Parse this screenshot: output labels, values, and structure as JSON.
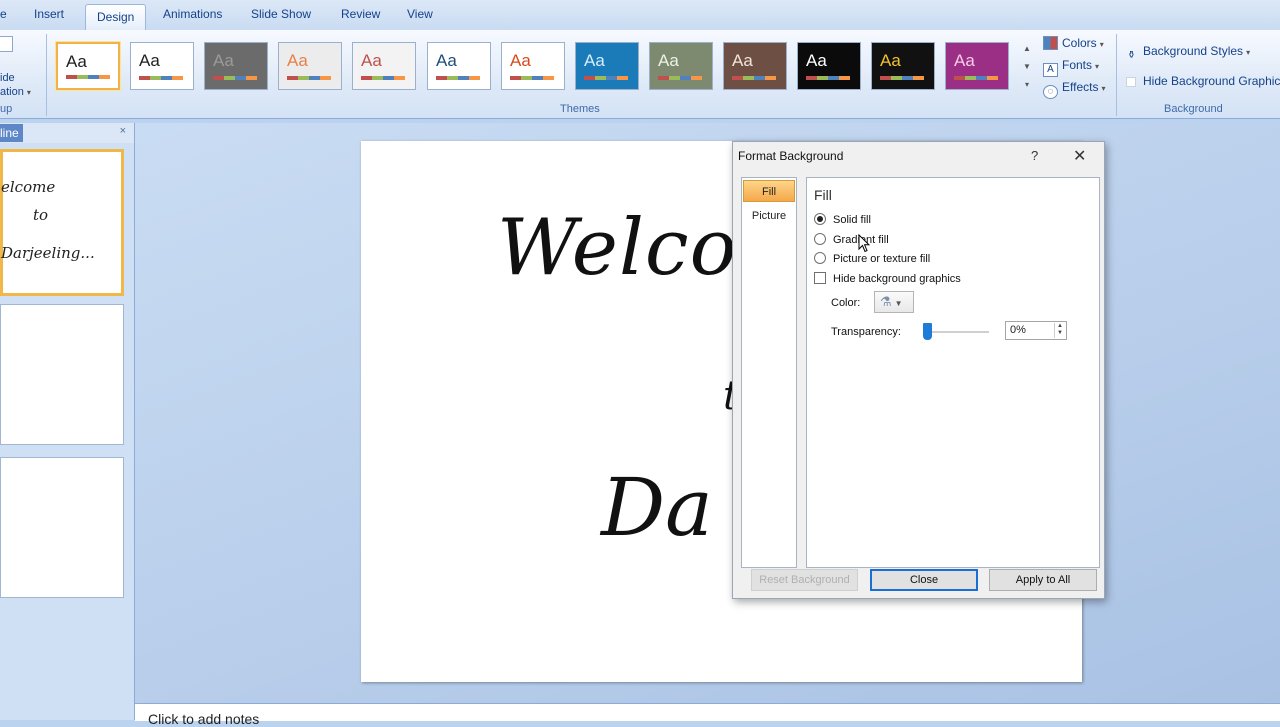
{
  "ribbon": {
    "tabs": [
      {
        "label": "e"
      },
      {
        "label": "Insert"
      },
      {
        "label": "Design"
      },
      {
        "label": "Animations"
      },
      {
        "label": "Slide Show"
      },
      {
        "label": "Review"
      },
      {
        "label": "View"
      }
    ],
    "active_tab": "Design",
    "left_group": {
      "line1": "ide",
      "line2": "ation",
      "label": "up"
    },
    "themes_label": "Themes",
    "theme_thumb_text": "Aa",
    "theme_items": [
      {
        "bg": "#ffffff",
        "fg": "#222222"
      },
      {
        "bg": "#ffffff",
        "fg": "#222222"
      },
      {
        "bg": "#6b6b6b",
        "fg": "#9a9a9a"
      },
      {
        "bg": "#ececec",
        "fg": "#e8804a"
      },
      {
        "bg": "#f3f3f3",
        "fg": "#c0504d"
      },
      {
        "bg": "#ffffff",
        "fg": "#1f4e79"
      },
      {
        "bg": "#ffffff",
        "fg": "#d84a1b"
      },
      {
        "bg": "#1a7bb8",
        "fg": "#d6eefc"
      },
      {
        "bg": "#7d8a70",
        "fg": "#eef2e6"
      },
      {
        "bg": "#6e4f44",
        "fg": "#f2e4d8"
      },
      {
        "bg": "#0b0b0b",
        "fg": "#ffffff"
      },
      {
        "bg": "#111111",
        "fg": "#f2c12e"
      },
      {
        "bg": "#9b2f86",
        "fg": "#f6cbe9"
      }
    ],
    "colors_label": "Colors",
    "fonts_label": "Fonts",
    "effects_label": "Effects",
    "bg_styles_label": "Background Styles",
    "hide_bg_graphics_label": "Hide Background Graphic",
    "background_label": "Background"
  },
  "left_pane": {
    "outline_tab": "line",
    "close": "×",
    "thumb1": {
      "line1": "elcome",
      "line2": "to",
      "line3": "Darjeeling..."
    }
  },
  "slide": {
    "title": "Welcom",
    "to": "t",
    "place": "Da"
  },
  "notes": {
    "placeholder": "Click to add notes"
  },
  "dialog": {
    "title": "Format Background",
    "help": "?",
    "close": "✕",
    "nav": [
      {
        "label": "Fill"
      },
      {
        "label": "Picture"
      }
    ],
    "heading": "Fill",
    "solid_fill": "Solid fill",
    "gradient_fill": "Gradient fill",
    "picture_texture_fill": "Picture or texture fill",
    "hide_bg_graphics": "Hide background graphics",
    "color_label": "Color:",
    "transparency_label": "Transparency:",
    "transparency_value": "0%",
    "transparency_fraction": 0,
    "reset_label": "Reset Background",
    "close_label": "Close",
    "apply_all_label": "Apply to All",
    "selected_fill": "solid"
  }
}
